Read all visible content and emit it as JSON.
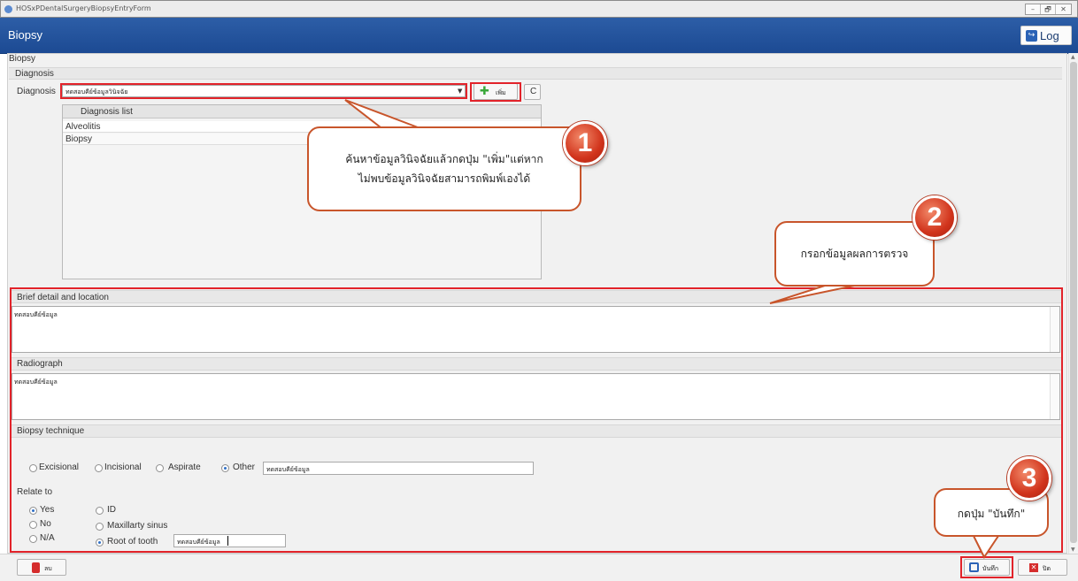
{
  "window": {
    "title": "HOSxPDentalSurgeryBiopsyEntryForm",
    "controls": [
      "–",
      "🗗",
      "✕"
    ]
  },
  "header": {
    "title": "Biopsy",
    "log_label": "Log"
  },
  "panel_title": "Biopsy",
  "diagnosis": {
    "section_title": "Diagnosis",
    "field_label": "Diagnosis",
    "value": "ทดสอบคีย์ข้อมูลวินิจฉัย",
    "add_label": "เพิ่ม",
    "clear_label": "C",
    "list_header": "Diagnosis list",
    "list_items": [
      "Alveolitis",
      "Biopsy"
    ]
  },
  "brief": {
    "title": "Brief detail and location",
    "value": "ทดสอบคีย์ข้อมูล"
  },
  "radiograph": {
    "title": "Radiograph",
    "value": "ทดสอบคีย์ข้อมูล"
  },
  "technique": {
    "title": "Biopsy technique",
    "options": [
      "Excisional",
      "Incisional",
      "Aspirate",
      "Other"
    ],
    "selected": "Other",
    "other_value": "ทดสอบคีย์ข้อมูล",
    "relate_label": "Relate to",
    "relate_options": [
      "Yes",
      "No",
      "N/A"
    ],
    "relate_selected": "Yes",
    "site_options": [
      "ID",
      "Maxillarty sinus",
      "Root of tooth"
    ],
    "site_selected": "Root of tooth",
    "root_value": "ทดสอบคีย์ข้อมูล"
  },
  "footer": {
    "delete_label": "ลบ",
    "save_label": "บันทึก",
    "close_label": "ปิด"
  },
  "callouts": [
    {
      "number": "1",
      "text_line1": "ค้นหาข้อมูลวินิจฉัยแล้วกดปุ่ม \"เพิ่ม\"แต่หาก",
      "text_line2": "ไม่พบข้อมูลวินิจฉัยสามารถพิมพ์เองได้"
    },
    {
      "number": "2",
      "text_line1": "กรอกข้อมูลผลการตรวจ"
    },
    {
      "number": "3",
      "text_line1": "กดปุ่ม \"บันทึก\""
    }
  ],
  "colors": {
    "header": "#1f4f98",
    "annotation_red": "#e2232a",
    "callout_border": "#c8552b"
  }
}
